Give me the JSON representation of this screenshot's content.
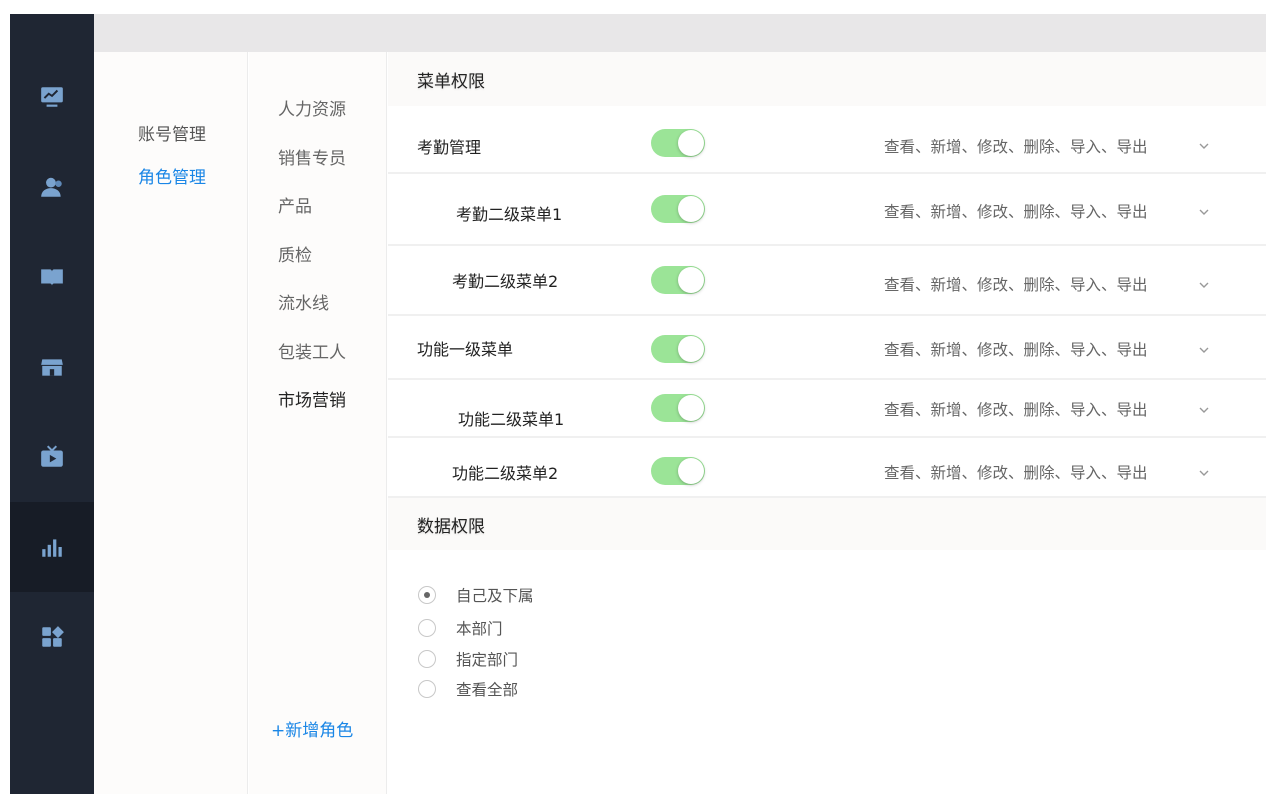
{
  "sidebar": {
    "items": [
      {
        "icon": "monitor-chart-icon",
        "active": false
      },
      {
        "icon": "user-icon",
        "active": false
      },
      {
        "icon": "book-icon",
        "active": false
      },
      {
        "icon": "store-icon",
        "active": false
      },
      {
        "icon": "tv-play-icon",
        "active": false
      },
      {
        "icon": "bar-chart-icon",
        "active": true
      },
      {
        "icon": "apps-grid-icon",
        "active": false
      }
    ],
    "icon_color": "#7aa3cf"
  },
  "nav": {
    "items": [
      {
        "label": "账号管理",
        "active": false
      },
      {
        "label": "角色管理",
        "active": true
      }
    ]
  },
  "roles": {
    "items": [
      {
        "label": "人力资源",
        "active": false
      },
      {
        "label": "销售专员",
        "active": false
      },
      {
        "label": "产品",
        "active": false
      },
      {
        "label": "质检",
        "active": false
      },
      {
        "label": "流水线",
        "active": false
      },
      {
        "label": "包装工人",
        "active": false
      },
      {
        "label": "市场营销",
        "active": true
      }
    ],
    "add_label": "+新增角色"
  },
  "menu_permissions": {
    "title": "菜单权限",
    "rows": [
      {
        "name": "考勤管理",
        "enabled": true,
        "actions": "查看、新增、修改、删除、导入、导出"
      },
      {
        "name": "考勤二级菜单1",
        "enabled": true,
        "actions": "查看、新增、修改、删除、导入、导出"
      },
      {
        "name": "考勤二级菜单2",
        "enabled": true,
        "actions": "查看、新增、修改、删除、导入、导出"
      },
      {
        "name": "功能一级菜单",
        "enabled": true,
        "actions": "查看、新增、修改、删除、导入、导出"
      },
      {
        "name": "功能二级菜单1",
        "enabled": true,
        "actions": "查看、新增、修改、删除、导入、导出"
      },
      {
        "name": "功能二级菜单2",
        "enabled": true,
        "actions": "查看、新增、修改、删除、导入、导出"
      }
    ]
  },
  "data_permissions": {
    "title": "数据权限",
    "options": [
      {
        "label": "自己及下属",
        "checked": true
      },
      {
        "label": "本部门",
        "checked": false
      },
      {
        "label": "指定部门",
        "checked": false
      },
      {
        "label": "查看全部",
        "checked": false
      }
    ]
  },
  "colors": {
    "accent": "#1a86e6",
    "toggle_on": "#9be497",
    "sidebar_bg": "#1f2633"
  }
}
